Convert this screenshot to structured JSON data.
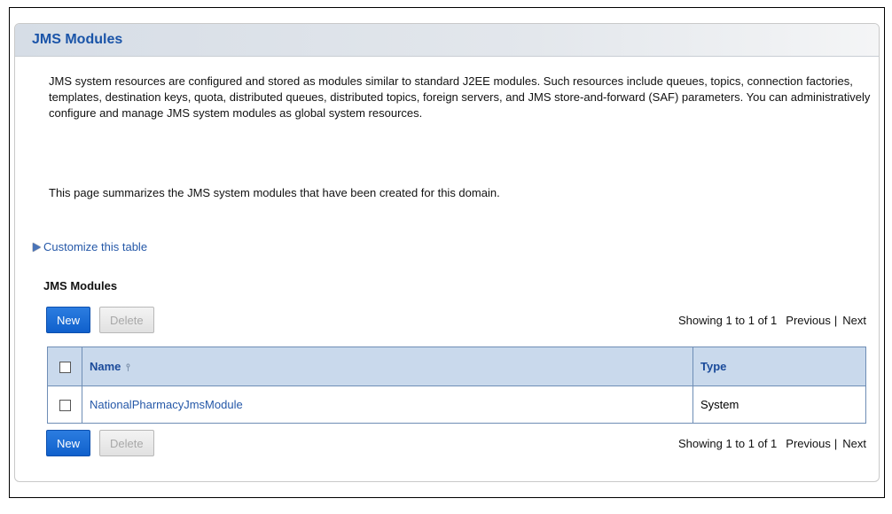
{
  "panel": {
    "title": "JMS Modules"
  },
  "description": {
    "paragraph1": "JMS system resources are configured and stored as modules similar to standard J2EE modules. Such resources include queues, topics, connection factories, templates, destination keys, quota, distributed queues, distributed topics, foreign servers, and JMS store-and-forward (SAF) parameters. You can administratively configure and manage JMS system modules as global system resources.",
    "paragraph2": "This page summarizes the JMS system modules that have been created for this domain."
  },
  "customize": {
    "label": "Customize this table",
    "icon": "expand-triangle-icon"
  },
  "table": {
    "title": "JMS Modules",
    "buttons": {
      "new_label": "New",
      "delete_label": "Delete"
    },
    "paging": {
      "summary": "Showing 1 to 1 of 1",
      "previous": "Previous",
      "separator": "|",
      "next": "Next"
    },
    "columns": {
      "name": "Name",
      "type": "Type"
    },
    "sort_icon": "sort-ascending-icon",
    "rows": [
      {
        "name": "NationalPharmacyJmsModule",
        "type": "System"
      }
    ]
  },
  "colors": {
    "header_title": "#1a54a8",
    "link": "#2558a8",
    "new_button": "#1a6ad8",
    "table_header_bg": "#c9d9ec",
    "table_border": "#6e8db5"
  }
}
